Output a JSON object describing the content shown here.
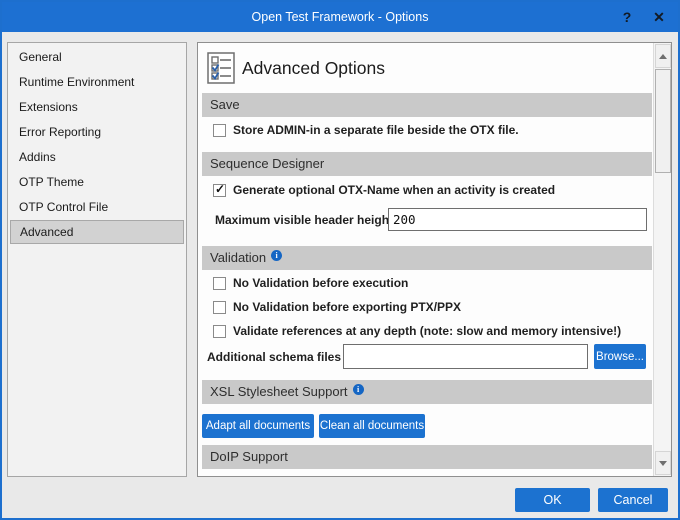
{
  "colors": {
    "accent": "#1d70d2",
    "section_header_bg": "#c9c9c9",
    "selected_item_bg": "#d2d2d2"
  },
  "window": {
    "title": "Open Test Framework - Options",
    "help": "?",
    "close": "✕"
  },
  "sidebar": {
    "items": [
      {
        "label": "General"
      },
      {
        "label": "Runtime Environment"
      },
      {
        "label": "Extensions"
      },
      {
        "label": "Error Reporting"
      },
      {
        "label": "Addins"
      },
      {
        "label": "OTP Theme"
      },
      {
        "label": "OTP Control File"
      },
      {
        "label": "Advanced"
      }
    ],
    "selected": "Advanced"
  },
  "content": {
    "page_title": "Advanced Options",
    "save": {
      "header": "Save",
      "checkbox_label": "Store ADMIN-in a separate file beside the OTX file.",
      "checked": false
    },
    "sequence_designer": {
      "header": "Sequence Designer",
      "checkbox_label": "Generate optional OTX-Name when an activity is created",
      "checked": true,
      "max_header_label": "Maximum visible header height:",
      "max_header_value": "200"
    },
    "validation": {
      "header": "Validation",
      "checkboxes": [
        "No Validation before execution",
        "No Validation before exporting PTX/PPX",
        "Validate references at any depth (note: slow and memory intensive!)"
      ],
      "schema_label": "Additional schema files",
      "schema_value": "",
      "browse_label": "Browse..."
    },
    "xsl": {
      "header": "XSL Stylesheet Support",
      "adapt_label": "Adapt all documents",
      "clean_label": "Clean all documents"
    },
    "doip": {
      "header": "DoIP Support"
    }
  },
  "footer": {
    "ok_label": "OK",
    "cancel_label": "Cancel"
  }
}
